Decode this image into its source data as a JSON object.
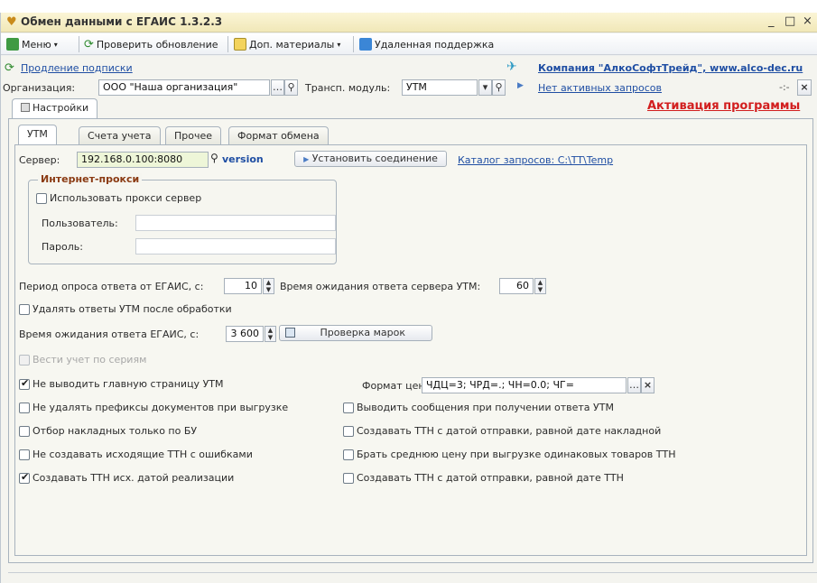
{
  "window": {
    "title": "Обмен данными с ЕГАИС 1.3.2.3",
    "min_glyph": "_",
    "max_glyph": "□",
    "close_glyph": "×"
  },
  "toolbar": {
    "menu_label": "Меню",
    "check_update_label": "Проверить обновление",
    "materials_label": "Доп. материалы",
    "remote_support_label": "Удаленная поддержка"
  },
  "header": {
    "subscription_link": "Продление подписки",
    "company_link": "Компания \"АлкоСофтТрейд\", www.alco-dec.ru",
    "org_label": "Организация:",
    "org_value": "ООО \"Наша организация\"",
    "transport_label": "Трансп. модуль:",
    "transport_value": "УТМ",
    "active_requests_link": "Нет активных запросов",
    "activation_label": "Активация программы"
  },
  "outer_tab": {
    "label": "Настройки"
  },
  "tabs": [
    {
      "label": "УТМ"
    },
    {
      "label": "Счета учета"
    },
    {
      "label": "Прочее"
    },
    {
      "label": "Формат обмена"
    }
  ],
  "utm": {
    "server_label": "Сервер:",
    "server_value": "192.168.0.100:8080",
    "version_link": "version",
    "connect_button": "Установить соединение",
    "catalog_link": "Каталог запросов: C:\\TT\\Temp",
    "proxy": {
      "title": "Интернет-прокси",
      "use_proxy_label": "Использовать прокси сервер",
      "user_label": "Пользователь:",
      "user_value": "",
      "password_label": "Пароль:",
      "password_value": ""
    },
    "poll_period_label": "Период опроса ответа от ЕГАИС, с:",
    "poll_period_value": "10",
    "utm_wait_label": "Время ожидания ответа сервера УТМ:",
    "utm_wait_value": "60",
    "delete_answers_label": "Удалять ответы УТМ после обработки",
    "egais_wait_label": "Время ожидания ответа ЕГАИС, с:",
    "egais_wait_value": "3 600",
    "check_marks_button": "Проверка марок",
    "series_label": "Вести учет по сериям",
    "price_format_label": "Формат цены:",
    "price_format_value": "ЧДЦ=3; ЧРД=.; ЧН=0.0; ЧГ=",
    "options_left": [
      {
        "label": "Не выводить главную страницу УТМ",
        "checked": true
      },
      {
        "label": "Не удалять префиксы документов при выгрузке",
        "checked": false
      },
      {
        "label": "Отбор накладных только по БУ",
        "checked": false
      },
      {
        "label": "Не создавать исходящие ТТН с ошибками",
        "checked": false
      },
      {
        "label": "Создавать ТТН исх. датой реализации",
        "checked": true
      }
    ],
    "options_right": [
      {
        "label": "Выводить сообщения при получении ответа УТМ",
        "checked": false
      },
      {
        "label": "Создавать ТТН с датой отправки, равной дате накладной",
        "checked": false
      },
      {
        "label": "Брать среднюю цену при выгрузке одинаковых товаров ТТН",
        "checked": false
      },
      {
        "label": "Создавать ТТН с датой отправки, равной дате ТТН",
        "checked": false
      }
    ]
  },
  "colors": {
    "accent_link": "#1f4ea3",
    "activation": "#d21e1e",
    "group_title": "#8a3a12"
  }
}
